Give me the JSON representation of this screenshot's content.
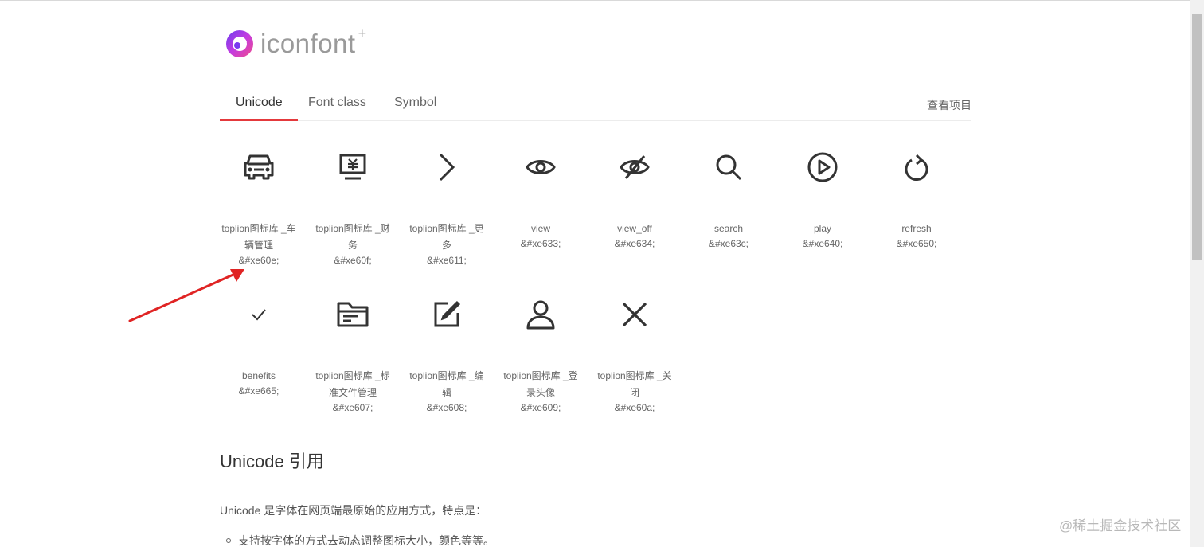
{
  "logo": {
    "text": "iconfont",
    "plus": "+"
  },
  "tabs": [
    {
      "label": "Unicode"
    },
    {
      "label": "Font class"
    },
    {
      "label": "Symbol"
    }
  ],
  "view_project": "查看项目",
  "icons": [
    {
      "name": "toplion图标库 _车辆管理",
      "code": "&#xe60e;",
      "icon": "car-icon"
    },
    {
      "name": "toplion图标库 _财务",
      "code": "&#xe60f;",
      "icon": "finance-icon"
    },
    {
      "name": "toplion图标库 _更多",
      "code": "&#xe611;",
      "icon": "chevron-right-icon"
    },
    {
      "name": "view",
      "code": "&#xe633;",
      "icon": "eye-icon"
    },
    {
      "name": "view_off",
      "code": "&#xe634;",
      "icon": "eye-off-icon"
    },
    {
      "name": "search",
      "code": "&#xe63c;",
      "icon": "search-icon"
    },
    {
      "name": "play",
      "code": "&#xe640;",
      "icon": "play-icon"
    },
    {
      "name": "refresh",
      "code": "&#xe650;",
      "icon": "refresh-icon"
    },
    {
      "name": "benefits",
      "code": "&#xe665;",
      "icon": "check-icon"
    },
    {
      "name": "toplion图标库 _标准文件管理",
      "code": "&#xe607;",
      "icon": "folder-icon"
    },
    {
      "name": "toplion图标库 _编辑",
      "code": "&#xe608;",
      "icon": "edit-icon"
    },
    {
      "name": "toplion图标库 _登录头像",
      "code": "&#xe609;",
      "icon": "user-icon"
    },
    {
      "name": "toplion图标库 _关闭",
      "code": "&#xe60a;",
      "icon": "close-icon"
    }
  ],
  "section": {
    "title": "Unicode 引用",
    "desc": "Unicode 是字体在网页端最原始的应用方式，特点是：",
    "bullets": [
      "支持按字体的方式去动态调整图标大小，颜色等等。"
    ]
  },
  "watermark": "@稀土掘金技术社区",
  "colors": {
    "accent": "#e4393c",
    "arrow": "#e02424",
    "icon": "#333333"
  }
}
